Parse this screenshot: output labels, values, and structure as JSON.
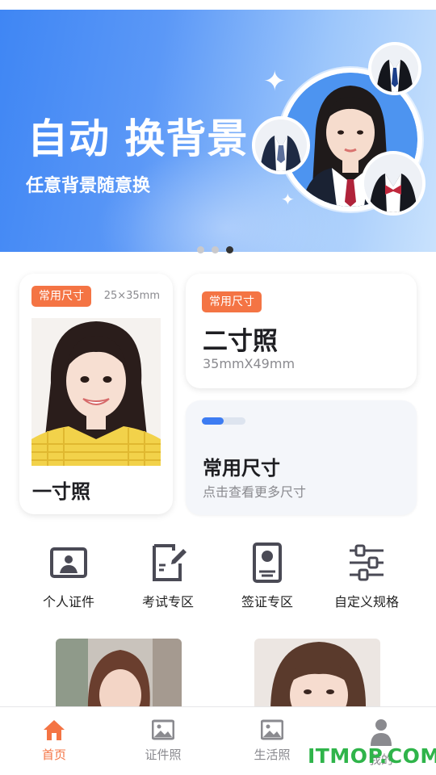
{
  "banner": {
    "title": "自动 换背景",
    "subtitle": "任意背景随意换",
    "page_count": 3,
    "active_index": 2
  },
  "cards": {
    "one_inch": {
      "tag": "常用尺寸",
      "size": "25×35mm",
      "name": "一寸照"
    },
    "two_inch": {
      "tag": "常用尺寸",
      "name": "二寸照",
      "size": "35mmX49mm"
    },
    "common": {
      "name": "常用尺寸",
      "hint": "点击查看更多尺寸"
    }
  },
  "functions": [
    {
      "label": "个人证件",
      "icon": "id-card-icon"
    },
    {
      "label": "考试专区",
      "icon": "exam-edit-icon"
    },
    {
      "label": "签证专区",
      "icon": "passport-icon"
    },
    {
      "label": "自定义规格",
      "icon": "adjust-sliders-icon"
    }
  ],
  "tabbar": {
    "items": [
      {
        "label": "首页",
        "icon": "home-icon",
        "active": true
      },
      {
        "label": "证件照",
        "icon": "image-icon",
        "active": false
      },
      {
        "label": "生活照",
        "icon": "image-icon",
        "active": false
      },
      {
        "label": "我的",
        "icon": "user-icon",
        "active": false
      }
    ]
  },
  "watermark": "ITMOP.COM",
  "colors": {
    "accent": "#f47444",
    "primary_blue": "#3d7cf2",
    "icon_dark": "#4a4a55",
    "watermark": "#2fb44a"
  }
}
